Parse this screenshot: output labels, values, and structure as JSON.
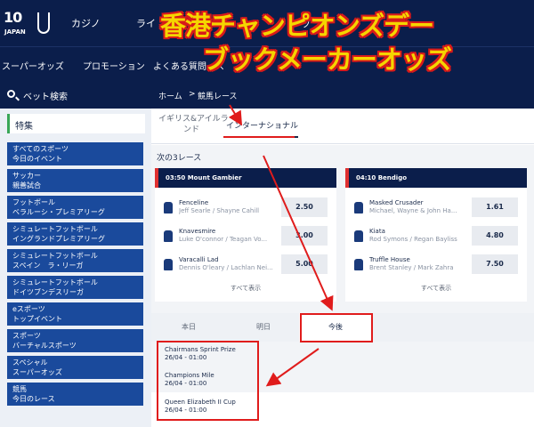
{
  "header": {
    "logo_main": "10",
    "logo_sub": "JAPAN",
    "nav": [
      "カジノ",
      "ライ",
      "ッ"
    ]
  },
  "subnav": [
    "スーパーオッズ",
    "プロモーション",
    "よくある質問",
    "ス"
  ],
  "sidebar": {
    "search_label": "ベット検索",
    "featured_label": "特集",
    "items": [
      {
        "line1": "すべてのスポーツ",
        "line2": "今日のイベント"
      },
      {
        "line1": "サッカー",
        "line2": "親善試合"
      },
      {
        "line1": "フットボール",
        "line2": "ベラルーシ・プレミアリーグ"
      },
      {
        "line1": "シミュレートフットボール",
        "line2": "イングランドプレミアリーグ"
      },
      {
        "line1": "シミュレートフットボール",
        "line2": "スペイン　ラ・リーガ"
      },
      {
        "line1": "シミュレートフットボール",
        "line2": "ドイツブンデスリーガ"
      },
      {
        "line1": "eスポーツ",
        "line2": "トップイベント"
      },
      {
        "line1": "スポーツ",
        "line2": "バーチャルスポーツ"
      },
      {
        "line1": "スペシャル",
        "line2": "スーパーオッズ"
      },
      {
        "line1": "競馬",
        "line2": "今日のレース"
      }
    ]
  },
  "breadcrumb": {
    "home": "ホーム",
    "separator": ">",
    "current": "競馬レース"
  },
  "region_tabs": {
    "tab1_line1": "イギリス&アイルラ",
    "tab1_line2": "ンド",
    "tab2": "インターナショナル"
  },
  "next_races": {
    "title": "次の3レース",
    "show_all": "すべて表示",
    "races": [
      {
        "header": "03:50 Mount Gambier",
        "runners": [
          {
            "name": "Fenceline",
            "jockeys": "Jeff Searle / Shayne Cahill",
            "odds": "2.50"
          },
          {
            "name": "Knavesmire",
            "jockeys": "Luke O'connor / Teagan Vo...",
            "odds": "3.00"
          },
          {
            "name": "Varacalli Lad",
            "jockeys": "Dennis O'leary / Lachlan Nei...",
            "odds": "5.00"
          }
        ]
      },
      {
        "header": "04:10 Bendigo",
        "runners": [
          {
            "name": "Masked Crusader",
            "jockeys": "Michael, Wayne & John Ha...",
            "odds": "1.61"
          },
          {
            "name": "Kiata",
            "jockeys": "Rod Symons / Regan Bayliss",
            "odds": "4.80"
          },
          {
            "name": "Truffle House",
            "jockeys": "Brent Stanley / Mark Zahra",
            "odds": "7.50"
          }
        ]
      }
    ]
  },
  "day_tabs": [
    "本日",
    "明日",
    "今後"
  ],
  "future_events": [
    {
      "name": "Chairmans Sprint Prize",
      "date": "26/04 - 01:00"
    },
    {
      "name": "Champions Mile",
      "date": "26/04 - 01:00"
    },
    {
      "name": "Queen Elizabeth II Cup",
      "date": "26/04 - 01:00"
    }
  ],
  "annotation": {
    "title_line1": "香港チャンピオンズデー",
    "title_line2": "ブックメーカーオッズ",
    "color_text": "#f5d500",
    "color_outline": "#d81a1a"
  }
}
